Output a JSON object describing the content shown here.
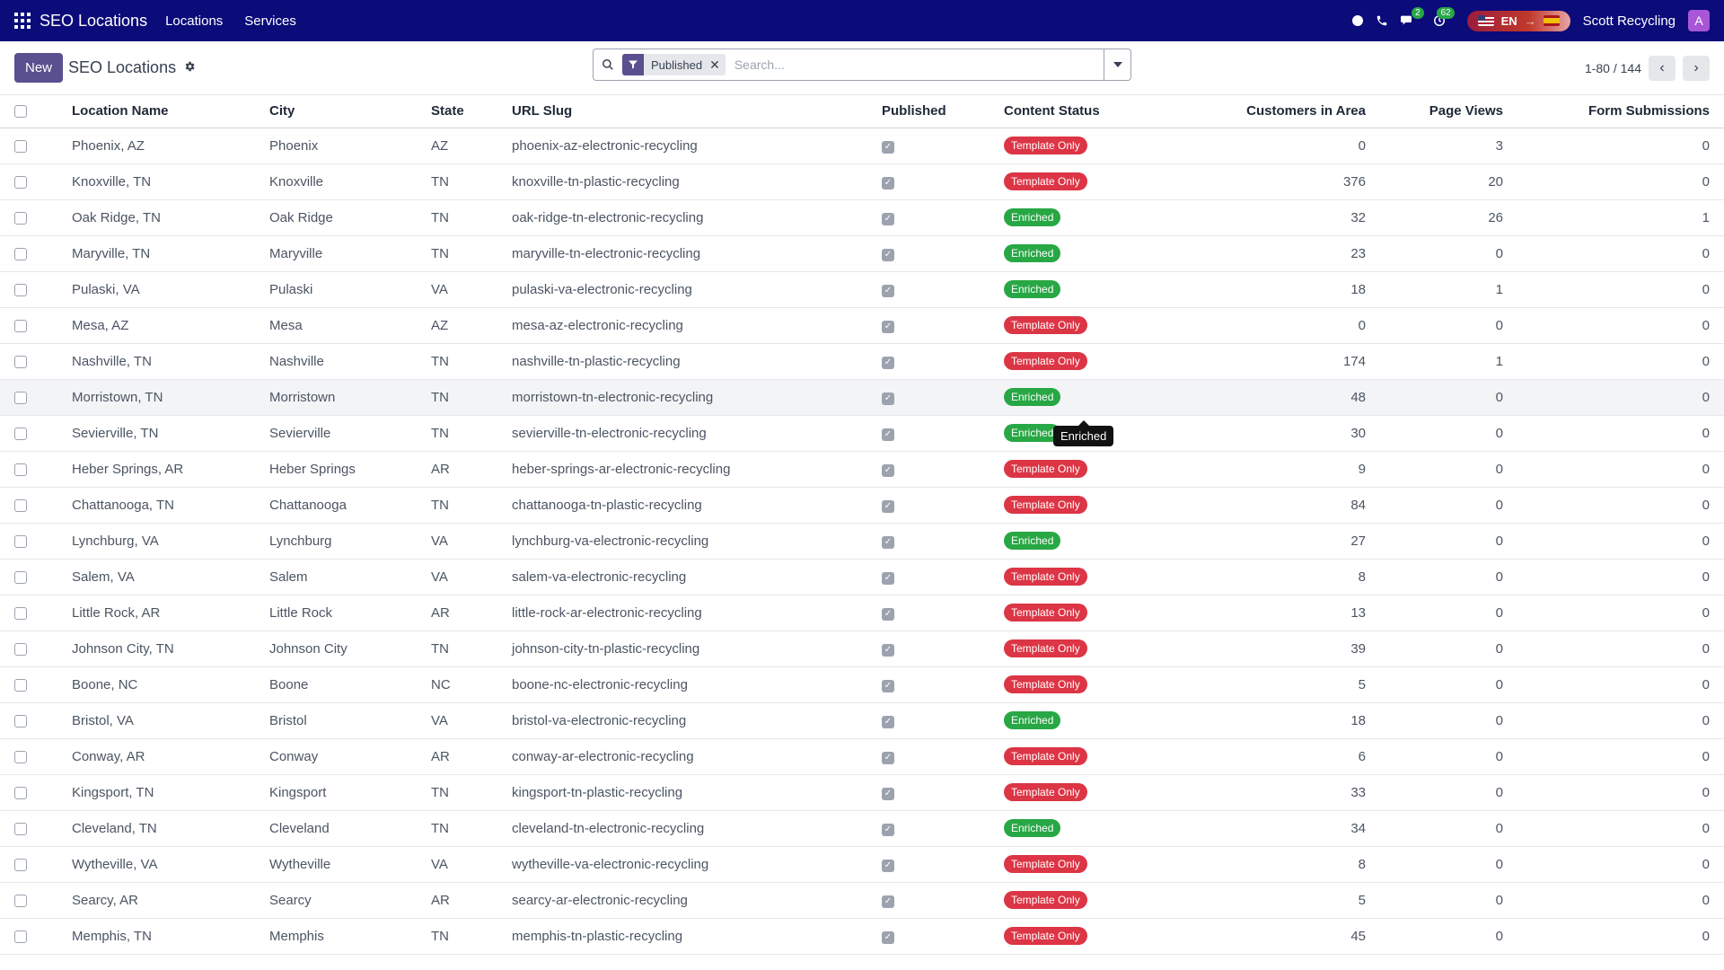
{
  "navbar": {
    "brand": "SEO Locations",
    "menus": [
      "Locations",
      "Services"
    ],
    "chat_count": "2",
    "activity_count": "62",
    "lang": "EN",
    "company": "Scott Recycling",
    "avatar_letter": "A"
  },
  "control": {
    "new_label": "New",
    "breadcrumb": "SEO Locations",
    "facet_label": "Published",
    "search_placeholder": "Search...",
    "pager": "1-80 / 144"
  },
  "table": {
    "headers": {
      "name": "Location Name",
      "city": "City",
      "state": "State",
      "slug": "URL Slug",
      "published": "Published",
      "status": "Content Status",
      "customers": "Customers in Area",
      "views": "Page Views",
      "forms": "Form Submissions"
    },
    "rows": [
      {
        "name": "Phoenix, AZ",
        "city": "Phoenix",
        "state": "AZ",
        "slug": "phoenix-az-electronic-recycling",
        "status": "Template Only",
        "customers": "0",
        "views": "3",
        "forms": "0"
      },
      {
        "name": "Knoxville, TN",
        "city": "Knoxville",
        "state": "TN",
        "slug": "knoxville-tn-plastic-recycling",
        "status": "Template Only",
        "customers": "376",
        "views": "20",
        "forms": "0"
      },
      {
        "name": "Oak Ridge, TN",
        "city": "Oak Ridge",
        "state": "TN",
        "slug": "oak-ridge-tn-electronic-recycling",
        "status": "Enriched",
        "customers": "32",
        "views": "26",
        "forms": "1"
      },
      {
        "name": "Maryville, TN",
        "city": "Maryville",
        "state": "TN",
        "slug": "maryville-tn-electronic-recycling",
        "status": "Enriched",
        "customers": "23",
        "views": "0",
        "forms": "0"
      },
      {
        "name": "Pulaski, VA",
        "city": "Pulaski",
        "state": "VA",
        "slug": "pulaski-va-electronic-recycling",
        "status": "Enriched",
        "customers": "18",
        "views": "1",
        "forms": "0"
      },
      {
        "name": "Mesa, AZ",
        "city": "Mesa",
        "state": "AZ",
        "slug": "mesa-az-electronic-recycling",
        "status": "Template Only",
        "customers": "0",
        "views": "0",
        "forms": "0"
      },
      {
        "name": "Nashville, TN",
        "city": "Nashville",
        "state": "TN",
        "slug": "nashville-tn-plastic-recycling",
        "status": "Template Only",
        "customers": "174",
        "views": "1",
        "forms": "0"
      },
      {
        "name": "Morristown, TN",
        "city": "Morristown",
        "state": "TN",
        "slug": "morristown-tn-electronic-recycling",
        "status": "Enriched",
        "customers": "48",
        "views": "0",
        "forms": "0"
      },
      {
        "name": "Sevierville, TN",
        "city": "Sevierville",
        "state": "TN",
        "slug": "sevierville-tn-electronic-recycling",
        "status": "Enriched",
        "customers": "30",
        "views": "0",
        "forms": "0"
      },
      {
        "name": "Heber Springs, AR",
        "city": "Heber Springs",
        "state": "AR",
        "slug": "heber-springs-ar-electronic-recycling",
        "status": "Template Only",
        "customers": "9",
        "views": "0",
        "forms": "0"
      },
      {
        "name": "Chattanooga, TN",
        "city": "Chattanooga",
        "state": "TN",
        "slug": "chattanooga-tn-plastic-recycling",
        "status": "Template Only",
        "customers": "84",
        "views": "0",
        "forms": "0"
      },
      {
        "name": "Lynchburg, VA",
        "city": "Lynchburg",
        "state": "VA",
        "slug": "lynchburg-va-electronic-recycling",
        "status": "Enriched",
        "customers": "27",
        "views": "0",
        "forms": "0"
      },
      {
        "name": "Salem, VA",
        "city": "Salem",
        "state": "VA",
        "slug": "salem-va-electronic-recycling",
        "status": "Template Only",
        "customers": "8",
        "views": "0",
        "forms": "0"
      },
      {
        "name": "Little Rock, AR",
        "city": "Little Rock",
        "state": "AR",
        "slug": "little-rock-ar-electronic-recycling",
        "status": "Template Only",
        "customers": "13",
        "views": "0",
        "forms": "0"
      },
      {
        "name": "Johnson City, TN",
        "city": "Johnson City",
        "state": "TN",
        "slug": "johnson-city-tn-plastic-recycling",
        "status": "Template Only",
        "customers": "39",
        "views": "0",
        "forms": "0"
      },
      {
        "name": "Boone, NC",
        "city": "Boone",
        "state": "NC",
        "slug": "boone-nc-electronic-recycling",
        "status": "Template Only",
        "customers": "5",
        "views": "0",
        "forms": "0"
      },
      {
        "name": "Bristol, VA",
        "city": "Bristol",
        "state": "VA",
        "slug": "bristol-va-electronic-recycling",
        "status": "Enriched",
        "customers": "18",
        "views": "0",
        "forms": "0"
      },
      {
        "name": "Conway, AR",
        "city": "Conway",
        "state": "AR",
        "slug": "conway-ar-electronic-recycling",
        "status": "Template Only",
        "customers": "6",
        "views": "0",
        "forms": "0"
      },
      {
        "name": "Kingsport, TN",
        "city": "Kingsport",
        "state": "TN",
        "slug": "kingsport-tn-plastic-recycling",
        "status": "Template Only",
        "customers": "33",
        "views": "0",
        "forms": "0"
      },
      {
        "name": "Cleveland, TN",
        "city": "Cleveland",
        "state": "TN",
        "slug": "cleveland-tn-electronic-recycling",
        "status": "Enriched",
        "customers": "34",
        "views": "0",
        "forms": "0"
      },
      {
        "name": "Wytheville, VA",
        "city": "Wytheville",
        "state": "VA",
        "slug": "wytheville-va-electronic-recycling",
        "status": "Template Only",
        "customers": "8",
        "views": "0",
        "forms": "0"
      },
      {
        "name": "Searcy, AR",
        "city": "Searcy",
        "state": "AR",
        "slug": "searcy-ar-electronic-recycling",
        "status": "Template Only",
        "customers": "5",
        "views": "0",
        "forms": "0"
      },
      {
        "name": "Memphis, TN",
        "city": "Memphis",
        "state": "TN",
        "slug": "memphis-tn-plastic-recycling",
        "status": "Template Only",
        "customers": "45",
        "views": "0",
        "forms": "0"
      }
    ]
  },
  "tooltip": "Enriched",
  "colors": {
    "navbar": "#0b0b7a",
    "primary": "#5a4f8f",
    "template_only": "#dc3545",
    "enriched": "#28a745"
  }
}
